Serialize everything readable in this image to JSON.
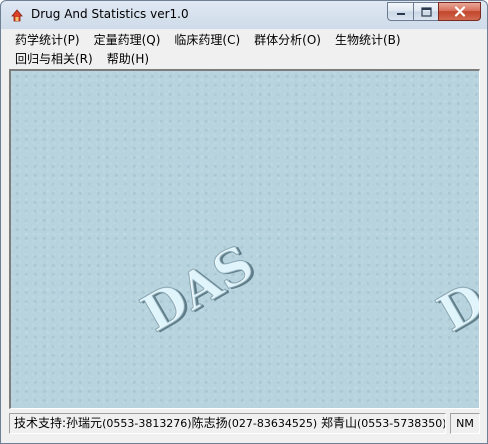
{
  "window": {
    "title": "Drug And Statistics ver1.0"
  },
  "caption_buttons": {
    "minimize_icon": "minimize-icon",
    "maximize_icon": "maximize-icon",
    "close_icon": "close-icon"
  },
  "menu": {
    "row1": [
      {
        "label": "药学统计(P)"
      },
      {
        "label": "定量药理(Q)"
      },
      {
        "label": "临床药理(C)"
      },
      {
        "label": "群体分析(O)"
      },
      {
        "label": "生物统计(B)"
      }
    ],
    "row2": [
      {
        "label": "回归与相关(R)"
      },
      {
        "label": "帮助(H)"
      }
    ]
  },
  "client": {
    "watermark_text": "DAS",
    "background_color": "#b6d3de",
    "watermark_color": "#c9e1ea"
  },
  "statusbar": {
    "support_label": "技术支持:",
    "contacts": [
      {
        "name": "孙瑞元",
        "phone": "(0553-3813276)"
      },
      {
        "name": "陈志扬",
        "phone": "(027-83634525)"
      },
      {
        "name": "郑青山",
        "phone": "(0553-5738350)"
      }
    ],
    "num_lock": "NM"
  }
}
